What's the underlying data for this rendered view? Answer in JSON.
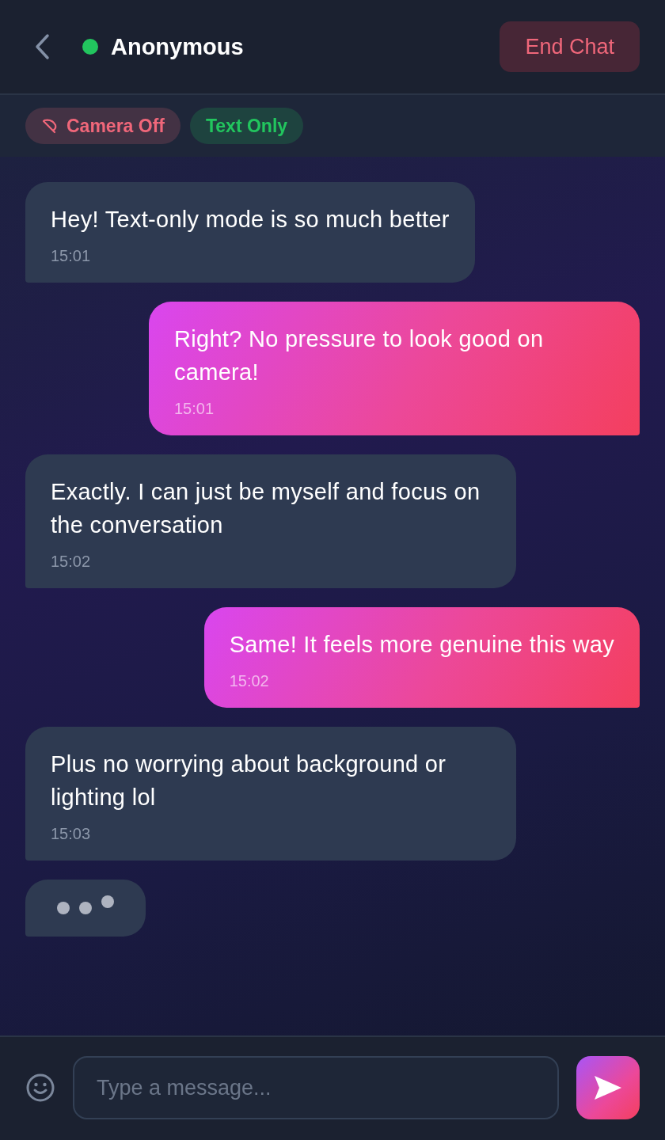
{
  "header": {
    "title": "Anonymous",
    "online": true,
    "end_button": "End Chat"
  },
  "badges": [
    {
      "label": "Camera Off",
      "kind": "camera",
      "color": "#f0677a"
    },
    {
      "label": "Text Only",
      "kind": "mode",
      "color": "#22c55e"
    }
  ],
  "messages": [
    {
      "kind": "them",
      "text": "Hey! Text-only mode is so much better",
      "time": "15:01"
    },
    {
      "kind": "me",
      "text": "Right? No pressure to look good on camera!",
      "time": "15:01"
    },
    {
      "kind": "them",
      "text": "Exactly. I can just be myself and focus on the conversation",
      "time": "15:02"
    },
    {
      "kind": "me",
      "text": "Same! It feels more genuine this way",
      "time": "15:02"
    },
    {
      "kind": "them",
      "text": "Plus no worrying about background or lighting lol",
      "time": "15:03"
    }
  ],
  "typing": true,
  "composer": {
    "placeholder": "Type a message..."
  }
}
